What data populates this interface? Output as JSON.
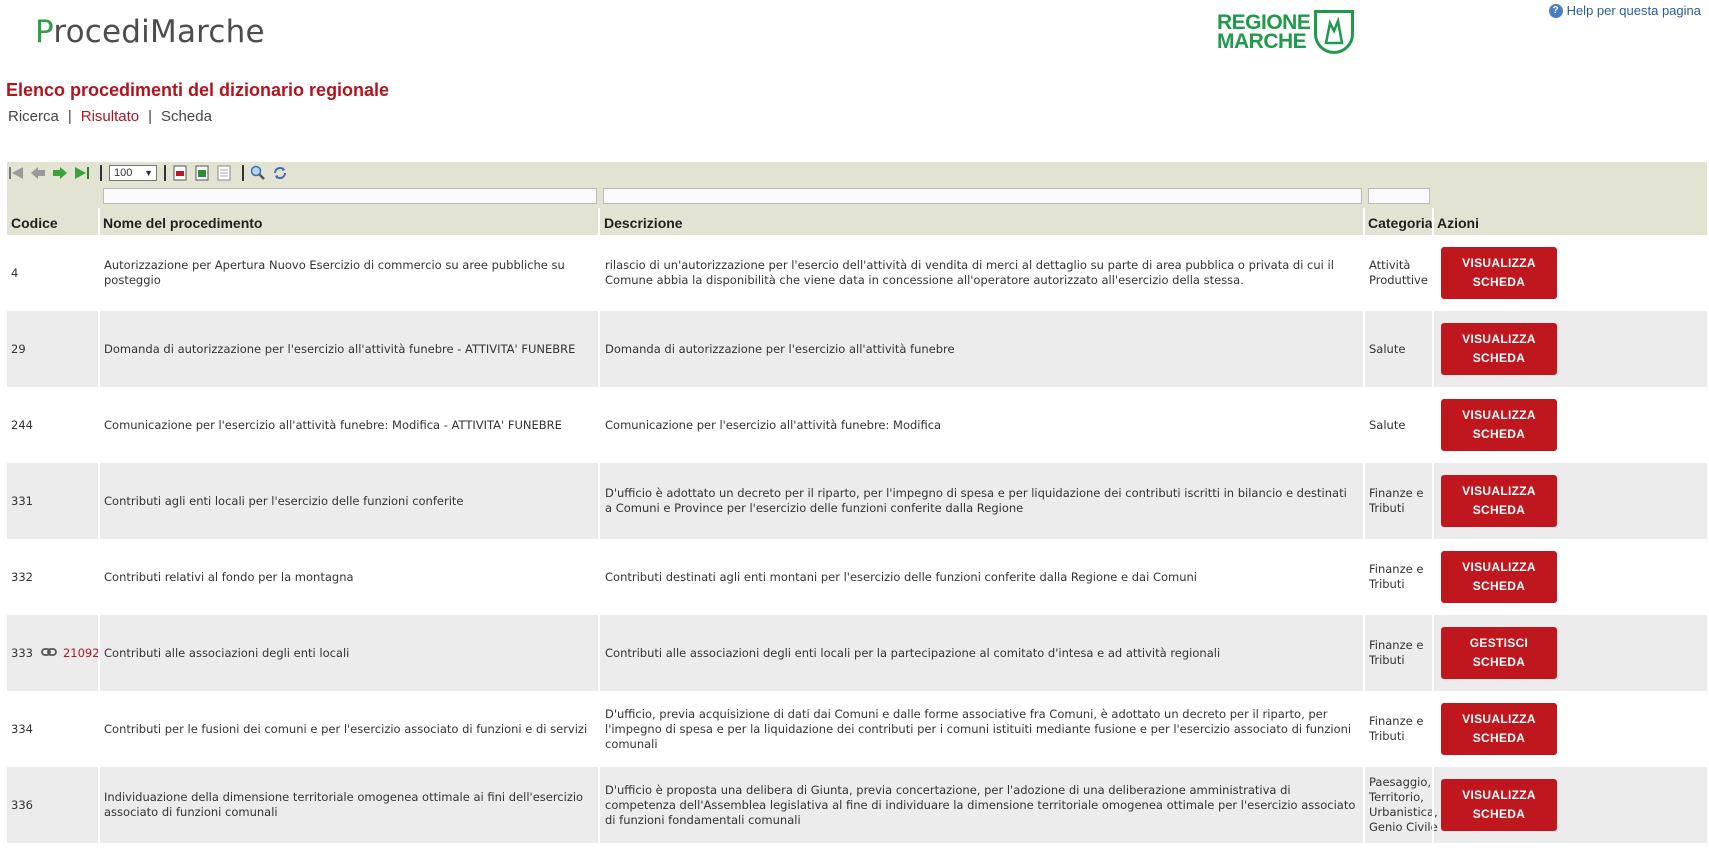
{
  "app": {
    "logo_first": "P",
    "logo_rest": "rocediMarche",
    "regione_line1": "REGIONE",
    "regione_line2": "MARCHE",
    "help": "Help per questa pagina"
  },
  "page": {
    "title": "Elenco procedimenti del dizionario regionale",
    "tabs": [
      {
        "label": "Ricerca",
        "active": false
      },
      {
        "label": "Risultato",
        "active": true
      },
      {
        "label": "Scheda",
        "active": false
      }
    ]
  },
  "toolbar": {
    "page_size": "100",
    "icons": [
      "first-page-icon",
      "prev-page-icon",
      "next-page-icon",
      "last-page-icon",
      "export-pdf-icon",
      "export-excel-icon",
      "export-text-icon",
      "search-icon",
      "refresh-icon"
    ]
  },
  "table": {
    "headers": [
      "Codice",
      "Nome del procedimento",
      "Descrizione",
      "Categoria",
      "Azioni"
    ],
    "rows": [
      {
        "codice": "4",
        "nome": "Autorizzazione per Apertura Nuovo Esercizio di commercio su aree pubbliche su posteggio",
        "descrizione": "rilascio di un'autorizzazione per l'esercio dell'attività di vendita di merci al dettaglio su parte di area pubblica o privata di cui il Comune abbia la disponibilità che viene data in concessione all'operatore autorizzato all'esercizio della stessa.",
        "categoria": "Attività Produttive",
        "azione_line1": "VISUALIZZA",
        "azione_line2": "SCHEDA",
        "link": ""
      },
      {
        "codice": "29",
        "nome": "Domanda di autorizzazione per l'esercizio all'attività funebre - ATTIVITA' FUNEBRE",
        "descrizione": "Domanda di autorizzazione per l'esercizio all'attività funebre",
        "categoria": "Salute",
        "azione_line1": "VISUALIZZA",
        "azione_line2": "SCHEDA",
        "link": ""
      },
      {
        "codice": "244",
        "nome": "Comunicazione per l'esercizio all'attività funebre: Modifica - ATTIVITA' FUNEBRE",
        "descrizione": "Comunicazione per l'esercizio all'attività funebre: Modifica",
        "categoria": "Salute",
        "azione_line1": "VISUALIZZA",
        "azione_line2": "SCHEDA",
        "link": ""
      },
      {
        "codice": "331",
        "nome": "Contributi agli enti locali per l'esercizio delle funzioni conferite",
        "descrizione": "D'ufficio è adottato un decreto per il riparto, per l'impegno di spesa e per liquidazione dei contributi iscritti in bilancio e destinati a Comuni e Province per l'esercizio delle funzioni conferite dalla Regione",
        "categoria": "Finanze e Tributi",
        "azione_line1": "VISUALIZZA",
        "azione_line2": "SCHEDA",
        "link": ""
      },
      {
        "codice": "332",
        "nome": "Contributi relativi al fondo per la montagna",
        "descrizione": "Contributi destinati agli enti montani per l'esercizio delle funzioni conferite dalla Regione e dai Comuni",
        "categoria": "Finanze e Tributi",
        "azione_line1": "VISUALIZZA",
        "azione_line2": "SCHEDA",
        "link": ""
      },
      {
        "codice": "333",
        "nome": "Contributi alle associazioni degli enti locali",
        "descrizione": "Contributi alle associazioni degli enti locali per la partecipazione al comitato d'intesa e ad attività regionali",
        "categoria": "Finanze e Tributi",
        "azione_line1": "GESTISCI",
        "azione_line2": "SCHEDA",
        "link": "21092"
      },
      {
        "codice": "334",
        "nome": "Contributi per le fusioni dei comuni e per l'esercizio associato di funzioni e di servizi",
        "descrizione": "D'ufficio, previa acquisizione di dati dai Comuni e dalle forme associative fra Comuni, è adottato un decreto per il riparto, per l'impegno di spesa e per la liquidazione dei contributi per i comuni istituiti mediante fusione e per l'esercizio associato di funzioni comunali",
        "categoria": "Finanze e Tributi",
        "azione_line1": "VISUALIZZA",
        "azione_line2": "SCHEDA",
        "link": ""
      },
      {
        "codice": "336",
        "nome": "Individuazione della dimensione territoriale omogenea ottimale ai fini dell'esercizio associato di funzioni comunali",
        "descrizione": "D'ufficio è proposta una delibera di Giunta, previa concertazione, per l'adozione di una deliberazione amministrativa di competenza dell'Assemblea legislativa al fine di individuare la dimensione territoriale omogenea ottimale per l'esercizio associato di funzioni fondamentali comunali",
        "categoria": "Paesaggio, Territorio, Urbanistica, Genio Civile",
        "azione_line1": "VISUALIZZA",
        "azione_line2": "SCHEDA",
        "link": ""
      }
    ]
  },
  "colors": {
    "brand_red": "#c0161d",
    "title_red": "#b2151f",
    "brand_green": "#1f9a4a",
    "header_bg": "#e3e3d3",
    "alt_row_bg": "#ececec"
  }
}
